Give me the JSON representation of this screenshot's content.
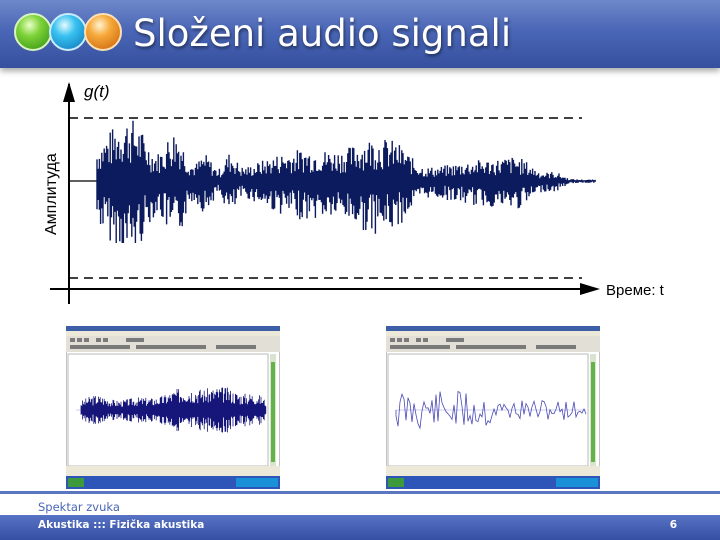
{
  "slide": {
    "title": "Složeni audio signali",
    "section": "Spektar zvuka",
    "breadcrumb": "Akustika ::: Fizička akustika",
    "page_number": "6"
  },
  "icons": [
    "green-bubble-icon",
    "cyan-bubble-icon",
    "orange-bubble-icon"
  ],
  "colors": {
    "header": "#4a66b6",
    "waveform": "#0c1a5e",
    "light_waveform": "#5c5cc4",
    "accent": "#3550a3"
  },
  "main_chart": {
    "y_axis_title": "g(t)",
    "y_axis_label": "Амплитуда",
    "x_axis_label": "Време: t"
  },
  "screenshots": [
    {
      "id": "left",
      "waveform": "dense speech waveform"
    },
    {
      "id": "right",
      "waveform": "sparse waveform"
    }
  ]
}
